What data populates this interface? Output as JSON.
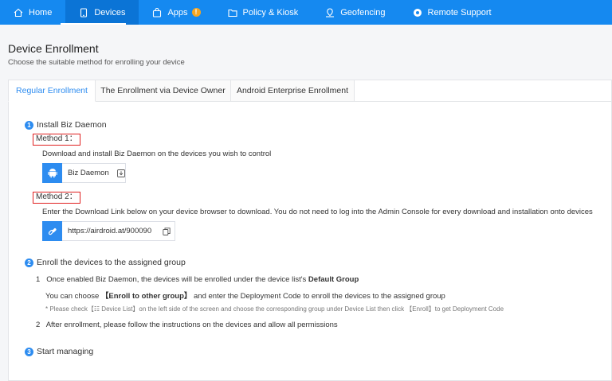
{
  "nav": {
    "items": [
      {
        "label": "Home",
        "icon": "home-icon"
      },
      {
        "label": "Devices",
        "icon": "phone-icon"
      },
      {
        "label": "Apps",
        "icon": "apps-bag-icon",
        "badge": "!"
      },
      {
        "label": "Policy & Kiosk",
        "icon": "folder-icon"
      },
      {
        "label": "Geofencing",
        "icon": "location-icon"
      },
      {
        "label": "Remote Support",
        "icon": "lifebuoy-icon"
      }
    ],
    "active": "Devices",
    "background": "#1589f0"
  },
  "page": {
    "title": "Device Enrollment",
    "subtitle": "Choose the suitable method for enrolling your device"
  },
  "tabs": [
    {
      "label": "Regular Enrollment",
      "selected": true
    },
    {
      "label": "The Enrollment via Device Owner",
      "selected": false
    },
    {
      "label": "Android Enterprise Enrollment",
      "selected": false
    }
  ],
  "step1": {
    "number": "1",
    "title": "Install Biz Daemon",
    "method1": {
      "label": "Method 1：",
      "description": "Download and install Biz Daemon on the devices you wish to control",
      "chip_label": "Biz Daemon"
    },
    "method2": {
      "label": "Method 2：",
      "description": "Enter the Download Link below on your device browser to download. You do not need to log into the Admin Console for every download and installation onto devices",
      "link": "https://airdroid.at/900090"
    }
  },
  "step2": {
    "number": "2",
    "title": "Enroll the devices to the assigned group",
    "item1_num": "1",
    "item1_text": "Once enabled Biz Daemon, the devices will be enrolled under the device list's",
    "item1_bold": "Default Group",
    "choose_pre": "You can choose",
    "choose_bold": "【Enroll to other group】",
    "choose_post": "and enter the Deployment Code to enroll the devices to the assigned group",
    "note": "* Please check【☷ Device List】on the left side of the screen and choose the corresponding group under Device List then click 【Enroll】to get Deployment Code",
    "item2_num": "2",
    "item2_text": "After enrollment, please follow the instructions on the devices and allow all permissions"
  },
  "step3": {
    "number": "3",
    "title": "Start managing"
  },
  "colors": {
    "accent": "#2d8cf0",
    "highlight_border": "#e02020"
  }
}
